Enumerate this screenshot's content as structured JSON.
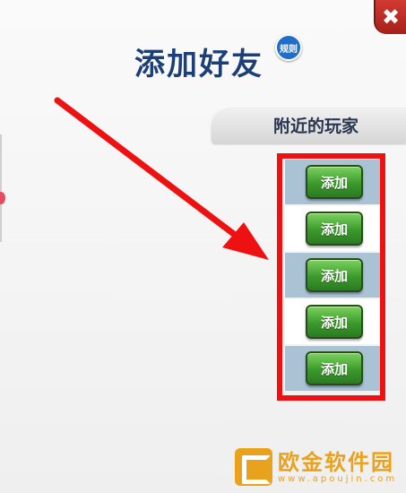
{
  "dialog": {
    "title": "添加好友",
    "rules_badge": "规则",
    "close_glyph": "✖"
  },
  "section": {
    "title": "附近的玩家"
  },
  "players": [
    {
      "add_label": "添加"
    },
    {
      "add_label": "添加"
    },
    {
      "add_label": "添加"
    },
    {
      "add_label": "添加"
    },
    {
      "add_label": "添加"
    }
  ],
  "annotation": {
    "color": "#ee1111"
  },
  "watermark": {
    "name": "欧金软件园",
    "url": "www.apoujin.com"
  },
  "colors": {
    "title": "#1c3f78",
    "add_button": "#3b9a2c",
    "row_shaded": "#a9c2d4",
    "close": "#c7302a",
    "watermark": "#e9a21c"
  }
}
